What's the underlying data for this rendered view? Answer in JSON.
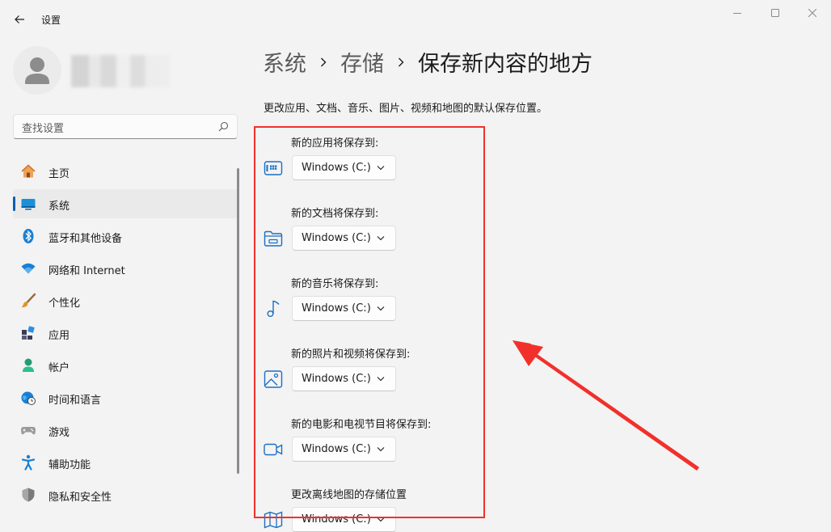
{
  "window": {
    "title": "设置",
    "controls": [
      "minimize",
      "maximize",
      "close"
    ]
  },
  "sidebar": {
    "search_placeholder": "查找设置",
    "items": [
      {
        "label": "主页",
        "icon": "home-icon"
      },
      {
        "label": "系统",
        "icon": "system-icon",
        "selected": true
      },
      {
        "label": "蓝牙和其他设备",
        "icon": "bluetooth-icon"
      },
      {
        "label": "网络和 Internet",
        "icon": "wifi-icon"
      },
      {
        "label": "个性化",
        "icon": "brush-icon"
      },
      {
        "label": "应用",
        "icon": "apps-icon"
      },
      {
        "label": "帐户",
        "icon": "account-icon"
      },
      {
        "label": "时间和语言",
        "icon": "globe-clock-icon"
      },
      {
        "label": "游戏",
        "icon": "gamepad-icon"
      },
      {
        "label": "辅助功能",
        "icon": "accessibility-icon"
      },
      {
        "label": "隐私和安全性",
        "icon": "shield-icon"
      }
    ]
  },
  "main": {
    "breadcrumb": [
      "系统",
      "存储",
      "保存新内容的地方"
    ],
    "description": "更改应用、文档、音乐、图片、视频和地图的默认保存位置。",
    "rows": [
      {
        "label": "新的应用将保存到:",
        "icon": "app-storage-icon",
        "value": "Windows (C:)"
      },
      {
        "label": "新的文档将保存到:",
        "icon": "folder-icon",
        "value": "Windows (C:)"
      },
      {
        "label": "新的音乐将保存到:",
        "icon": "music-note-icon",
        "value": "Windows (C:)"
      },
      {
        "label": "新的照片和视频将保存到:",
        "icon": "photo-icon",
        "value": "Windows (C:)"
      },
      {
        "label": "新的电影和电视节目将保存到:",
        "icon": "video-camera-icon",
        "value": "Windows (C:)"
      },
      {
        "label": "更改离线地图的存储位置",
        "icon": "map-icon",
        "value": "Windows (C:)"
      }
    ]
  },
  "colors": {
    "accent": "#005fb8",
    "annotation": "#f2302b",
    "background": "#f3f3f3"
  }
}
